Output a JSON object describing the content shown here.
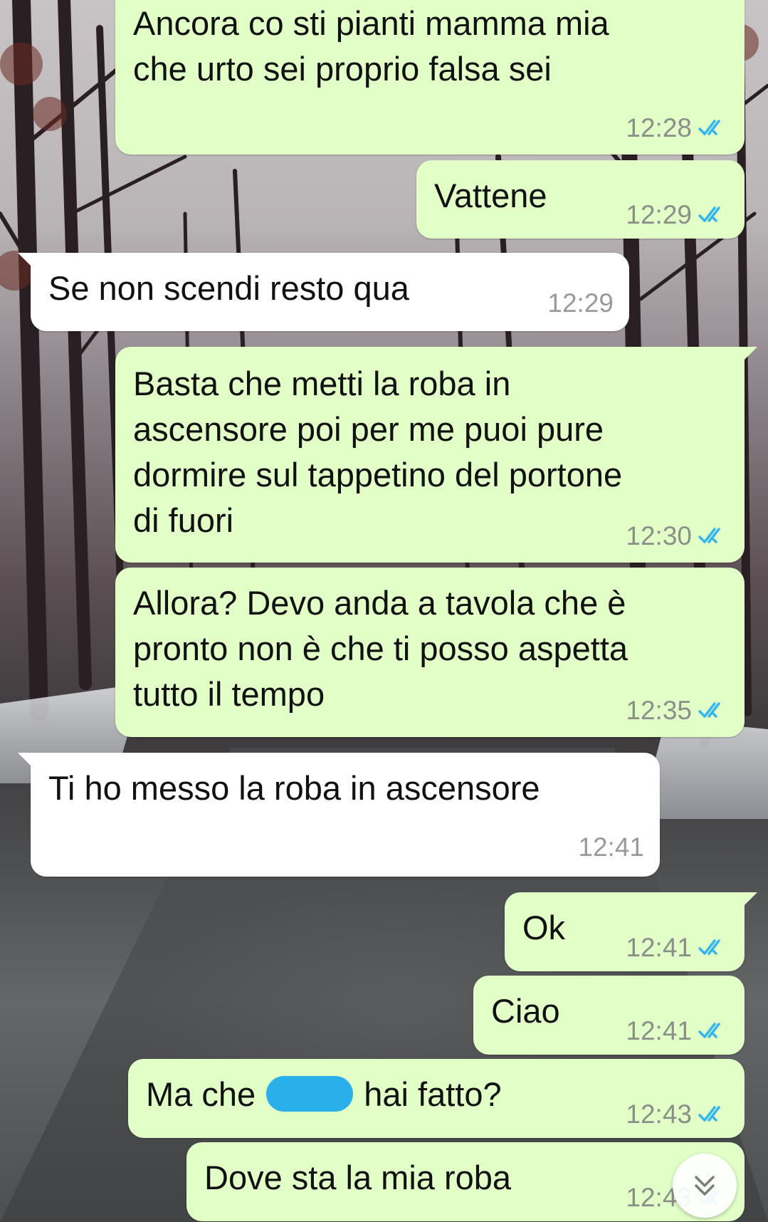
{
  "messages": [
    {
      "id": "m1",
      "direction": "outgoing",
      "text": "Ancora co sti pianti mamma mia\nche urto sei proprio falsa sei",
      "time": "12:28",
      "status": "read"
    },
    {
      "id": "m2",
      "direction": "outgoing",
      "text": "Vattene",
      "time": "12:29",
      "status": "read"
    },
    {
      "id": "m3",
      "direction": "incoming",
      "text": "Se non scendi resto qua",
      "time": "12:29"
    },
    {
      "id": "m4",
      "direction": "outgoing",
      "text": "Basta che metti la roba in\nascensore poi per me puoi pure\ndormire sul tappetino del portone\ndi fuori",
      "time": "12:30",
      "status": "read"
    },
    {
      "id": "m5",
      "direction": "outgoing",
      "text": "Allora? Devo anda a tavola che è\npronto non è che ti posso aspetta\ntutto il tempo",
      "time": "12:35",
      "status": "read"
    },
    {
      "id": "m6",
      "direction": "incoming",
      "text": "Ti ho messo la roba in ascensore",
      "time": "12:41"
    },
    {
      "id": "m7",
      "direction": "outgoing",
      "text": "Ok",
      "time": "12:41",
      "status": "read"
    },
    {
      "id": "m8",
      "direction": "outgoing",
      "text": "Ciao",
      "time": "12:41",
      "status": "read"
    },
    {
      "id": "m9",
      "direction": "outgoing",
      "text_before": "Ma che",
      "text_after": "hai fatto?",
      "time": "12:43",
      "status": "read",
      "redaction_color": "#29b0ea"
    },
    {
      "id": "m10",
      "direction": "outgoing",
      "text": "Dove sta la mia roba",
      "time": "12:43",
      "status": "read"
    }
  ],
  "icons": {
    "read_ticks": "double-check-icon",
    "scroll_down": "double-chevron-down-icon"
  },
  "colors": {
    "outgoing_bubble": "#e1ffc7",
    "incoming_bubble": "#ffffff",
    "read_tick": "#34b7f1",
    "timestamp": "#8a8f8a"
  }
}
